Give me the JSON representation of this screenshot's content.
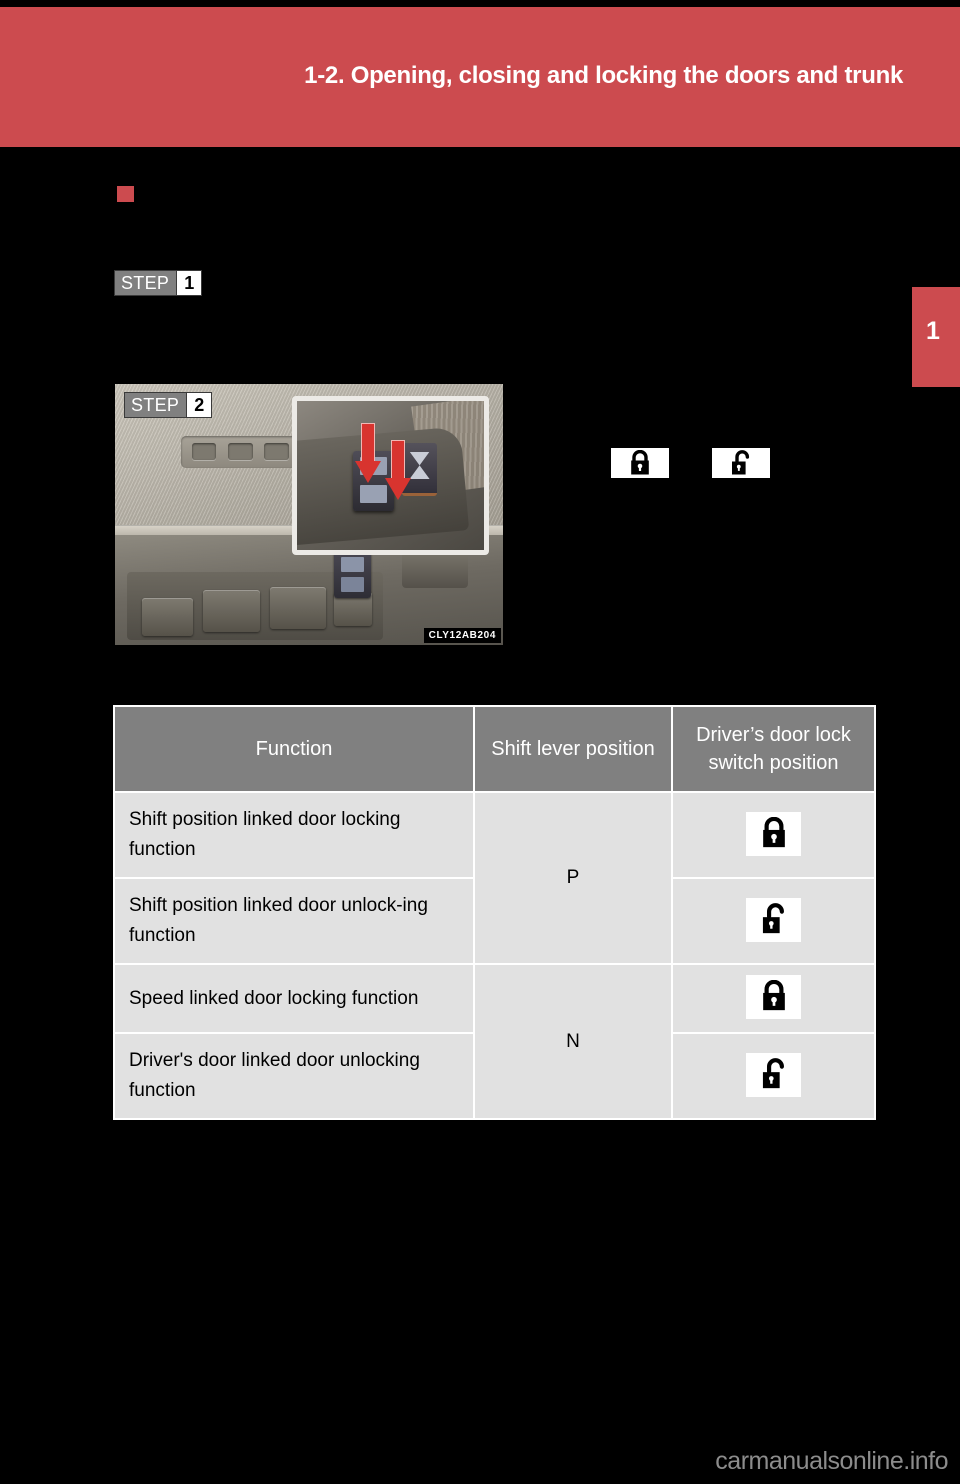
{
  "header": {
    "title": "1-2. Opening, closing and locking the doors and trunk"
  },
  "chapter_tab": {
    "number": "1"
  },
  "section": {
    "bullet_color": "#cc4b4f",
    "heading": ""
  },
  "body": {
    "intro_paragraph": "",
    "step1_text": "",
    "step2_text": "",
    "step2_text_2": "",
    "after_table_note": ""
  },
  "steps": [
    {
      "word": "STEP",
      "number": "1"
    },
    {
      "word": "STEP",
      "number": "2"
    }
  ],
  "photo": {
    "caption": "CLY12AB204",
    "alt_name": "driver-door-panel-with-lock-switch"
  },
  "inline_icons": [
    {
      "name": "lock-locked-icon",
      "state": "locked"
    },
    {
      "name": "lock-unlocked-icon",
      "state": "unlocked"
    }
  ],
  "table": {
    "headers": [
      "Function",
      "Shift lever position",
      "Driver’s door lock switch position"
    ],
    "rows": [
      {
        "function": "Shift position linked door locking function",
        "shift": "P",
        "switch_state": "locked"
      },
      {
        "function": "Shift position linked door unlock-ing function",
        "shift": "",
        "switch_state": "unlocked"
      },
      {
        "function": "Speed linked door locking function",
        "shift": "N",
        "switch_state": "locked"
      },
      {
        "function": "Driver's door linked door unlocking function",
        "shift": "",
        "switch_state": "unlocked"
      }
    ]
  },
  "colors": {
    "brand_red": "#cc4b4f",
    "table_header_gray": "#808080",
    "table_cell_gray": "#e1e1e1",
    "page_background": "#000000",
    "watermark_gray": "#8c8c8c"
  },
  "watermark": {
    "text": "carmanualsonline.info"
  }
}
